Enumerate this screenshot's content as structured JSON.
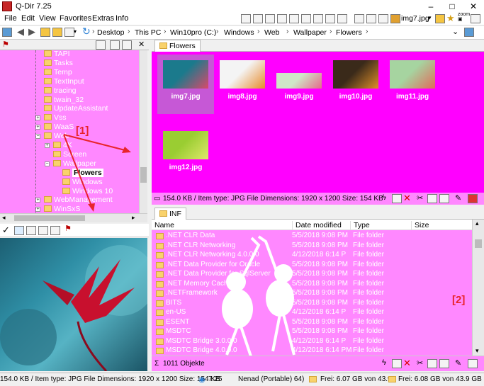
{
  "window": {
    "title": "Q-Dir 7.25",
    "controls": [
      "–",
      "□",
      "✕"
    ]
  },
  "menu": [
    "File",
    "Edit",
    "View",
    "Favorites",
    "Extras",
    "Info"
  ],
  "toolbar_right": {
    "current_file": "img7.jpg"
  },
  "address": {
    "segments": [
      "Desktop",
      "This PC",
      "Win10pro (C:)",
      "Windows",
      "Web",
      "Wallpaper",
      "Flowers"
    ]
  },
  "tree": {
    "items": [
      {
        "label": "TAPI",
        "level": 0,
        "expander": ""
      },
      {
        "label": "Tasks",
        "level": 0,
        "expander": ""
      },
      {
        "label": "Temp",
        "level": 0,
        "expander": ""
      },
      {
        "label": "TextInput",
        "level": 0,
        "expander": ""
      },
      {
        "label": "tracing",
        "level": 0,
        "expander": ""
      },
      {
        "label": "twain_32",
        "level": 0,
        "expander": ""
      },
      {
        "label": "UpdateAssistant",
        "level": 0,
        "expander": ""
      },
      {
        "label": "Vss",
        "level": 0,
        "expander": "+"
      },
      {
        "label": "WaaS",
        "level": 0,
        "expander": "+"
      },
      {
        "label": "Web",
        "level": 0,
        "expander": "−"
      },
      {
        "label": "4K",
        "level": 1,
        "expander": "+"
      },
      {
        "label": "Screen",
        "level": 1,
        "expander": ""
      },
      {
        "label": "Wallpaper",
        "level": 1,
        "expander": "−"
      },
      {
        "label": "Flowers",
        "level": 2,
        "expander": "",
        "selected": true
      },
      {
        "label": "Windows",
        "level": 2,
        "expander": ""
      },
      {
        "label": "Windows 10",
        "level": 2,
        "expander": ""
      },
      {
        "label": "WebManagement",
        "level": 0,
        "expander": "+"
      },
      {
        "label": "WinSxS",
        "level": 0,
        "expander": "+"
      }
    ]
  },
  "top_pane": {
    "tab": "Flowers",
    "thumbnails": [
      {
        "name": "img7.jpg",
        "c1": "#1b7a8c",
        "c2": "#d94a6a"
      },
      {
        "name": "img8.jpg",
        "c1": "#f4f4f4",
        "c2": "#e78a2a"
      },
      {
        "name": "img9.jpg",
        "c1": "#cfe6c8",
        "c2": "#e46a8a"
      },
      {
        "name": "img10.jpg",
        "c1": "#3a2a1a",
        "c2": "#e0902a"
      },
      {
        "name": "img11.jpg",
        "c1": "#a6d4a0",
        "c2": "#e06a5a"
      },
      {
        "name": "img12.jpg",
        "c1": "#9acd32",
        "c2": "#dfe86a"
      }
    ],
    "status": "154.0 KB / Item type: JPG File Dimensions: 1920 x 1200 Size: 154 KB"
  },
  "bottom_pane": {
    "tab": "INF",
    "columns": [
      "Name",
      "Date modified",
      "Type",
      "Size"
    ],
    "rows": [
      {
        "name": ".NET CLR Data",
        "date": "5/5/2018 9:08 PM",
        "type": "File folder"
      },
      {
        "name": ".NET CLR Networking",
        "date": "5/5/2018 9:08 PM",
        "type": "File folder"
      },
      {
        "name": ".NET CLR Networking 4.0.0.0",
        "date": "4/12/2018 6:14 P",
        "type": "File folder"
      },
      {
        "name": ".NET Data Provider for Oracle",
        "date": "5/5/2018 9:08 PM",
        "type": "File folder"
      },
      {
        "name": ".NET Data Provider for SqlServer",
        "date": "5/5/2018 9:08 PM",
        "type": "File folder"
      },
      {
        "name": ".NET Memory Cache 4.0",
        "date": "5/5/2018 9:08 PM",
        "type": "File folder"
      },
      {
        "name": ".NETFramework",
        "date": "5/5/2018 9:08 PM",
        "type": "File folder"
      },
      {
        "name": "BITS",
        "date": "5/5/2018 9:08 PM",
        "type": "File folder"
      },
      {
        "name": "en-US",
        "date": "4/12/2018 6:14 P",
        "type": "File folder"
      },
      {
        "name": "ESENT",
        "date": "5/5/2018 9:08 PM",
        "type": "File folder"
      },
      {
        "name": "MSDTC",
        "date": "5/5/2018 9:08 PM",
        "type": "File folder"
      },
      {
        "name": "MSDTC Bridge 3.0.0.0",
        "date": "4/12/2018 6:14 P",
        "type": "File folder"
      },
      {
        "name": "MSDTC Bridge 4.0.0.0",
        "date": "4/12/2018 6:14 PM",
        "type": "File folder"
      }
    ],
    "count": "1011 Objekte"
  },
  "statusbar": {
    "left": "154.0 KB / Item type: JPG File Dimensions: 1920 x 1200 Size: 154 KB",
    "version": "7.25",
    "user": "Nenad (Portable) 64)",
    "free1": "Frei: 6.07 GB von 43.9",
    "free2": "Frei: 6.08 GB von 43.9 GB"
  },
  "annotations": {
    "a1": "[1]",
    "a2": "[2]"
  },
  "colors": {
    "pane_bg": "#ff88ff",
    "thumb_bg": "#ff00ff",
    "annotation": "#e8242b"
  }
}
